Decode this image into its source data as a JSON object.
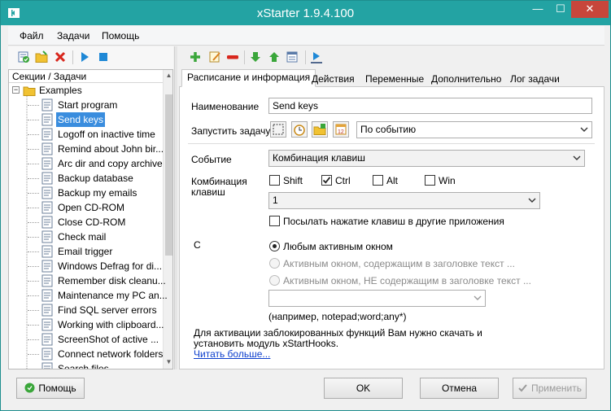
{
  "window": {
    "title": "xStarter 1.9.4.100",
    "minimize": "—",
    "maximize": "☐",
    "close": "✕"
  },
  "menu": [
    "Файл",
    "Задачи",
    "Помощь"
  ],
  "tree": {
    "header": "Секции / Задачи",
    "root": "Examples",
    "items": [
      "Start program",
      "Send keys",
      "Logoff on inactive time",
      "Remind about John bir...",
      "Arc dir and copy archive",
      "Backup database",
      "Backup my emails",
      "Open CD-ROM",
      "Close CD-ROM",
      "Check mail",
      "Email trigger",
      "Windows Defrag for di...",
      "Remember disk cleanu...",
      "Maintenance my PC an...",
      "Find SQL server errors",
      "Working with clipboard...",
      "ScreenShot of active ...",
      "Connect network folders",
      "Search files"
    ],
    "selected_index": 1
  },
  "tabs": [
    "Расписание и информация",
    "Действия",
    "Переменные",
    "Дополнительно",
    "Лог задачи"
  ],
  "active_tab": 0,
  "form": {
    "name_label": "Наименование",
    "name_value": "Send keys",
    "run_label": "Запустить задачу",
    "run_mode": "По событию",
    "event_label": "Событие",
    "event_value": "Комбинация клавиш",
    "combo_label_1": "Комбинация",
    "combo_label_2": "клавиш",
    "modifiers": [
      {
        "label": "Shift",
        "checked": false
      },
      {
        "label": "Ctrl",
        "checked": true
      },
      {
        "label": "Alt",
        "checked": false
      },
      {
        "label": "Win",
        "checked": false
      }
    ],
    "key_value": "1",
    "send_other_label": "Посылать нажатие клавиш в другие приложения",
    "send_other_checked": false,
    "c_label": "С",
    "radios": [
      {
        "label": "Любым активным окном",
        "checked": true,
        "enabled": true
      },
      {
        "label": "Активным окном, содержащим в заголовке текст ...",
        "checked": false,
        "enabled": false
      },
      {
        "label": "Активным окном, НЕ содержащим в заголовке текст ...",
        "checked": false,
        "enabled": false
      }
    ],
    "title_filter_value": "",
    "example_hint": "(например, notepad;word;any*)",
    "info_line_1": "Для активации заблокированных функций Вам нужно скачать и",
    "info_line_2": "установить модуль xStartHooks.",
    "read_more": "Читать больше..."
  },
  "buttons": {
    "help": "Помощь",
    "ok": "OK",
    "cancel": "Отмена",
    "apply": "Применить"
  },
  "colors": {
    "titlebar": "#23a3a3",
    "close": "#c7463b",
    "selection": "#3a8dde",
    "link": "#0b3dcc"
  }
}
